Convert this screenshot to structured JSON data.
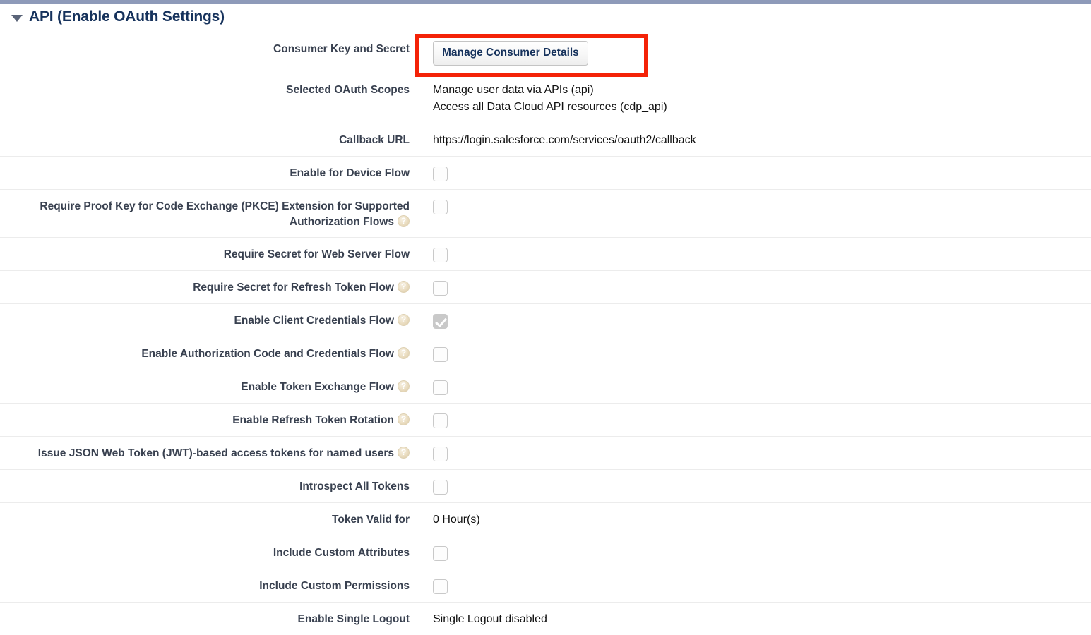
{
  "section": {
    "title": "API (Enable OAuth Settings)",
    "expanded": true,
    "twisty_icon": "triangle-down-icon"
  },
  "annotation": {
    "type": "red-rectangle-highlight",
    "color": "#f42207",
    "targets": "manage-consumer-details-button"
  },
  "rows": [
    {
      "label": "Consumer Key and Secret",
      "help": false,
      "kind": "button",
      "button_label": "Manage Consumer Details",
      "name": "consumer-key-and-secret"
    },
    {
      "label": "Selected OAuth Scopes",
      "help": false,
      "kind": "text-lines",
      "lines": [
        "Manage user data via APIs (api)",
        "Access all Data Cloud API resources (cdp_api)"
      ],
      "name": "selected-oauth-scopes"
    },
    {
      "label": "Callback URL",
      "help": false,
      "kind": "text",
      "value": "https://login.salesforce.com/services/oauth2/callback",
      "name": "callback-url"
    },
    {
      "label": "Enable for Device Flow",
      "help": false,
      "kind": "checkbox",
      "checked": false,
      "name": "enable-for-device-flow"
    },
    {
      "label": "Require Proof Key for Code Exchange (PKCE) Extension for Supported Authorization Flows",
      "help": true,
      "kind": "checkbox",
      "checked": false,
      "name": "require-pkce-extension"
    },
    {
      "label": "Require Secret for Web Server Flow",
      "help": false,
      "kind": "checkbox",
      "checked": false,
      "name": "require-secret-for-web-server-flow"
    },
    {
      "label": "Require Secret for Refresh Token Flow",
      "help": true,
      "kind": "checkbox",
      "checked": false,
      "name": "require-secret-for-refresh-token-flow"
    },
    {
      "label": "Enable Client Credentials Flow",
      "help": true,
      "kind": "checkbox",
      "checked": true,
      "name": "enable-client-credentials-flow"
    },
    {
      "label": "Enable Authorization Code and Credentials Flow",
      "help": true,
      "kind": "checkbox",
      "checked": false,
      "name": "enable-authorization-code-and-credentials-flow"
    },
    {
      "label": "Enable Token Exchange Flow",
      "help": true,
      "kind": "checkbox",
      "checked": false,
      "name": "enable-token-exchange-flow"
    },
    {
      "label": "Enable Refresh Token Rotation",
      "help": true,
      "kind": "checkbox",
      "checked": false,
      "name": "enable-refresh-token-rotation"
    },
    {
      "label": "Issue JSON Web Token (JWT)-based access tokens for named users",
      "help": true,
      "kind": "checkbox",
      "checked": false,
      "name": "issue-jwt-based-access-tokens"
    },
    {
      "label": "Introspect All Tokens",
      "help": false,
      "kind": "checkbox",
      "checked": false,
      "name": "introspect-all-tokens"
    },
    {
      "label": "Token Valid for",
      "help": false,
      "kind": "text",
      "value": "0 Hour(s)",
      "name": "token-valid-for"
    },
    {
      "label": "Include Custom Attributes",
      "help": false,
      "kind": "checkbox",
      "checked": false,
      "name": "include-custom-attributes"
    },
    {
      "label": "Include Custom Permissions",
      "help": false,
      "kind": "checkbox",
      "checked": false,
      "name": "include-custom-permissions"
    },
    {
      "label": "Enable Single Logout",
      "help": false,
      "kind": "text",
      "value": "Single Logout disabled",
      "name": "enable-single-logout"
    }
  ]
}
